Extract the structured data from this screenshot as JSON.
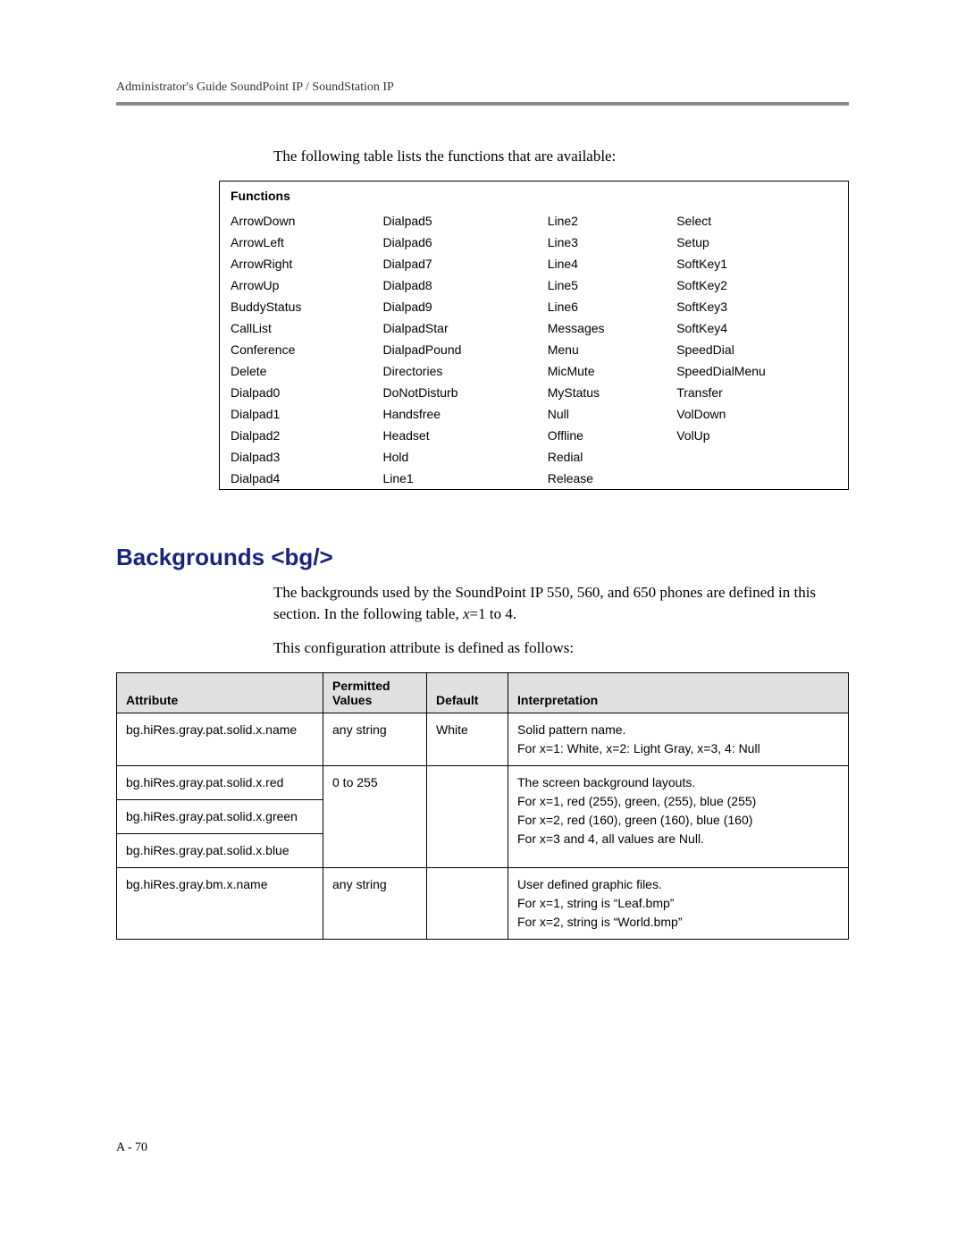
{
  "header": {
    "running": "Administrator's Guide SoundPoint IP / SoundStation IP"
  },
  "intro": "The following table lists the functions that are available:",
  "functions_header": "Functions",
  "functions": [
    [
      "ArrowDown",
      "Dialpad5",
      "Line2",
      "Select"
    ],
    [
      "ArrowLeft",
      "Dialpad6",
      "Line3",
      "Setup"
    ],
    [
      "ArrowRight",
      "Dialpad7",
      "Line4",
      "SoftKey1"
    ],
    [
      "ArrowUp",
      "Dialpad8",
      "Line5",
      "SoftKey2"
    ],
    [
      "BuddyStatus",
      "Dialpad9",
      "Line6",
      "SoftKey3"
    ],
    [
      "CallList",
      "DialpadStar",
      "Messages",
      "SoftKey4"
    ],
    [
      "Conference",
      "DialpadPound",
      "Menu",
      "SpeedDial"
    ],
    [
      "Delete",
      "Directories",
      "MicMute",
      "SpeedDialMenu"
    ],
    [
      "Dialpad0",
      "DoNotDisturb",
      "MyStatus",
      "Transfer"
    ],
    [
      "Dialpad1",
      "Handsfree",
      "Null",
      "VolDown"
    ],
    [
      "Dialpad2",
      "Headset",
      "Offline",
      "VolUp"
    ],
    [
      "Dialpad3",
      "Hold",
      "Redial",
      ""
    ],
    [
      "Dialpad4",
      "Line1",
      "Release",
      ""
    ]
  ],
  "section_heading": "Backgrounds <bg/>",
  "bg_paragraph1a": "The backgrounds used by the SoundPoint IP 550, 560, and 650 phones are defined in this section. In the following table, ",
  "bg_paragraph1b": "x",
  "bg_paragraph1c": "=1 to 4.",
  "bg_paragraph2": "This configuration attribute is defined as follows:",
  "attr_headers": {
    "attribute": "Attribute",
    "permitted": "Permitted Values",
    "default": "Default",
    "interpretation": "Interpretation"
  },
  "attr_rows": {
    "r1": {
      "attr": "bg.hiRes.gray.pat.solid.x.name",
      "perm": "any string",
      "def": "White",
      "interp_l1": "Solid pattern name.",
      "interp_l2": "For x=1: White, x=2: Light Gray, x=3, 4: Null"
    },
    "r2": {
      "attr1": "bg.hiRes.gray.pat.solid.x.red",
      "attr2": "bg.hiRes.gray.pat.solid.x.green",
      "attr3": "bg.hiRes.gray.pat.solid.x.blue",
      "perm": "0 to 255",
      "def": "",
      "interp_l1": "The screen background layouts.",
      "interp_l2": "For x=1, red (255), green, (255), blue (255)",
      "interp_l3": "For x=2, red (160), green (160), blue (160)",
      "interp_l4": "For x=3 and 4, all values are Null."
    },
    "r3": {
      "attr": "bg.hiRes.gray.bm.x.name",
      "perm": "any string",
      "def": "",
      "interp_l1": "User defined graphic files.",
      "interp_l2": "For x=1, string is “Leaf.bmp”",
      "interp_l3": "For x=2, string is “World.bmp”"
    }
  },
  "page_number": "A - 70"
}
